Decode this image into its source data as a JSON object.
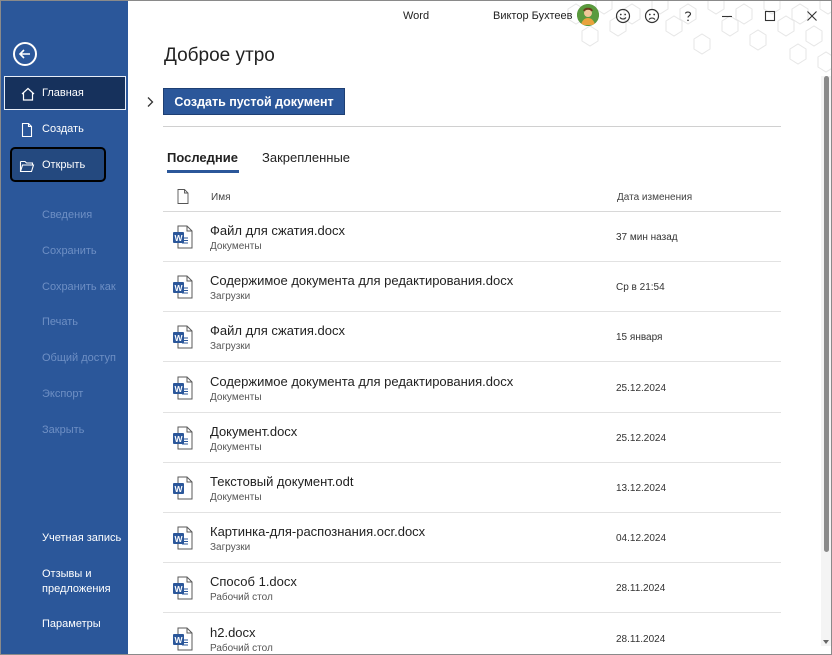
{
  "app": {
    "name": "Word"
  },
  "user": {
    "name": "Виктор Бухтеев"
  },
  "titlebar_icons": [
    "smile-icon",
    "frown-icon",
    "help-icon",
    "minimize-icon",
    "maximize-icon",
    "close-icon"
  ],
  "sidebar": {
    "back_icon": "back-arrow-icon",
    "items": [
      {
        "label": "Главная",
        "icon": "home-icon",
        "state": "active"
      },
      {
        "label": "Создать",
        "icon": "new-document-icon",
        "state": "normal"
      },
      {
        "label": "Открыть",
        "icon": "open-folder-icon",
        "state": "highlighted"
      },
      {
        "label": "Сведения",
        "state": "disabled"
      },
      {
        "label": "Сохранить",
        "state": "disabled"
      },
      {
        "label": "Сохранить как",
        "state": "disabled"
      },
      {
        "label": "Печать",
        "state": "disabled"
      },
      {
        "label": "Общий доступ",
        "state": "disabled"
      },
      {
        "label": "Экспорт",
        "state": "disabled"
      },
      {
        "label": "Закрыть",
        "state": "disabled"
      }
    ],
    "lower": {
      "account": "Учетная запись",
      "feedback_line1": "Отзывы и",
      "feedback_line2": "предложения",
      "options": "Параметры"
    }
  },
  "main": {
    "greeting": "Доброе утро",
    "new_blank_label": "Создать пустой документ",
    "tabs": [
      {
        "label": "Последние",
        "active": true
      },
      {
        "label": "Закрепленные",
        "active": false
      }
    ],
    "columns": {
      "name": "Имя",
      "modified": "Дата изменения"
    },
    "files": [
      {
        "name": "Файл для сжатия.docx",
        "location": "Документы",
        "date": "37 мин назад",
        "type": "docx"
      },
      {
        "name": "Содержимое документа для редактирования.docx",
        "location": "Загрузки",
        "date": "Ср в 21:54",
        "type": "docx"
      },
      {
        "name": "Файл для сжатия.docx",
        "location": "Загрузки",
        "date": "15 января",
        "type": "docx"
      },
      {
        "name": "Содержимое документа для редактирования.docx",
        "location": "Документы",
        "date": "25.12.2024",
        "type": "docx"
      },
      {
        "name": "Документ.docx",
        "location": "Документы",
        "date": "25.12.2024",
        "type": "docx"
      },
      {
        "name": "Текстовый документ.odt",
        "location": "Документы",
        "date": "13.12.2024",
        "type": "odt"
      },
      {
        "name": "Картинка-для-распознания.ocr.docx",
        "location": "Загрузки",
        "date": "04.12.2024",
        "type": "docx"
      },
      {
        "name": "Способ 1.docx",
        "location": "Рабочий стол",
        "date": "28.11.2024",
        "type": "docx"
      },
      {
        "name": "h2.docx",
        "location": "Рабочий стол",
        "date": "28.11.2024",
        "type": "docx"
      }
    ]
  },
  "colors": {
    "accent": "#2b579a",
    "sidebar_active": "#16315c",
    "disabled_text": "#6e8fc4"
  }
}
